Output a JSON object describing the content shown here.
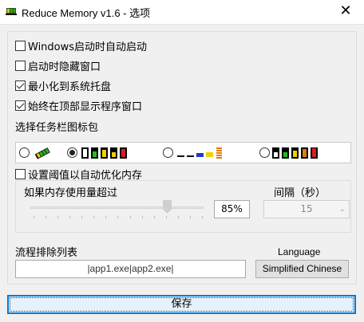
{
  "window": {
    "title": "Reduce Memory v1.6 - 选项",
    "close": "✕"
  },
  "options": {
    "startup": {
      "label": "Windows启动时自动启动",
      "checked": false
    },
    "hide_on_start": {
      "label": "启动时隐藏窗口",
      "checked": false
    },
    "minimize_to_tray": {
      "label": "最小化到系统托盘",
      "checked": true
    },
    "always_on_top": {
      "label": "始终在顶部显示程序窗口",
      "checked": true
    }
  },
  "icon_pack": {
    "label": "选择任务栏图标包",
    "selected_index": 1,
    "option_count": 4
  },
  "threshold": {
    "label": "设置阈值以自动优化内存",
    "checked": false,
    "usage_label": "如果内存使用量超过",
    "usage_value": "85%",
    "usage_fraction": 0.85,
    "interval_label": "间隔（秒）",
    "interval_value": "15"
  },
  "exclusion": {
    "label": "流程排除列表",
    "value": "|app1.exe|app2.exe|"
  },
  "language": {
    "label": "Language",
    "value": "Simplified Chinese"
  },
  "save_label": "保存",
  "colors": {
    "accent": "#0078d7",
    "chip_green": "#22c01e",
    "chip_yellow": "#f0d000",
    "chip_orange": "#e07a10",
    "chip_red": "#d62020",
    "chip_blue": "#1e3cc8"
  }
}
